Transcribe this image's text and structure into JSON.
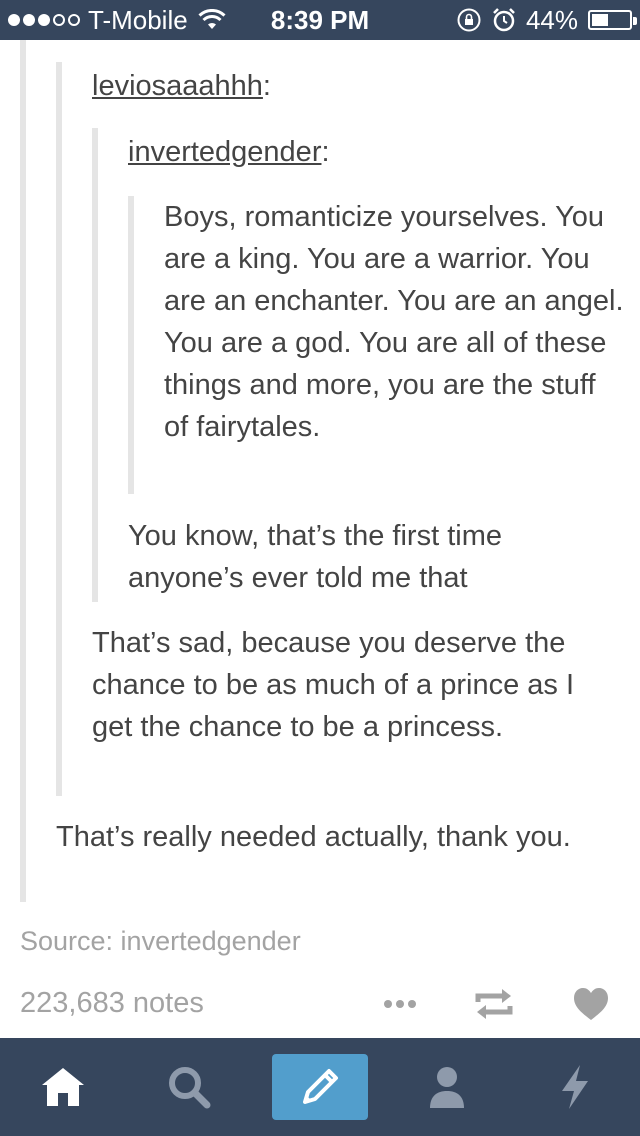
{
  "status_bar": {
    "carrier": "T-Mobile",
    "time": "8:39 PM",
    "battery_percent": "44%",
    "battery_level": 0.44,
    "signal_bars_filled": 3,
    "signal_bars_total": 5
  },
  "post": {
    "reblogs": [
      {
        "username": "leviosaaahhh",
        "colon": ":"
      },
      {
        "username": "invertedgender",
        "colon": ":"
      }
    ],
    "original_text": "Boys, romanticize yourselves. You are a king. You are a warrior. You are an enchanter. You are an angel. You are a god. You are all of these things and more, you are the stuff of fairytales.",
    "reply_1": "You know, that’s the first time anyone’s ever told me that",
    "reply_2": "That’s sad, because you deserve the chance to be as much of a prince as I get the chance to be a princess.",
    "reply_3": "That’s really needed actually, thank you.",
    "source": "Source: invertedgender",
    "notes": "223,683 notes"
  },
  "tab_bar": {
    "items": [
      {
        "name": "home-icon",
        "active": true
      },
      {
        "name": "search-icon",
        "active": false
      },
      {
        "name": "compose-icon",
        "active": false
      },
      {
        "name": "account-icon",
        "active": false
      },
      {
        "name": "activity-icon",
        "active": false
      }
    ]
  },
  "colors": {
    "status_bar_bg": "#36465d",
    "tab_bar_bg": "#36465d",
    "compose_bg": "#529ecc",
    "text": "#444444",
    "muted": "#a3a3a3",
    "quote_bar": "#e5e5e5"
  }
}
